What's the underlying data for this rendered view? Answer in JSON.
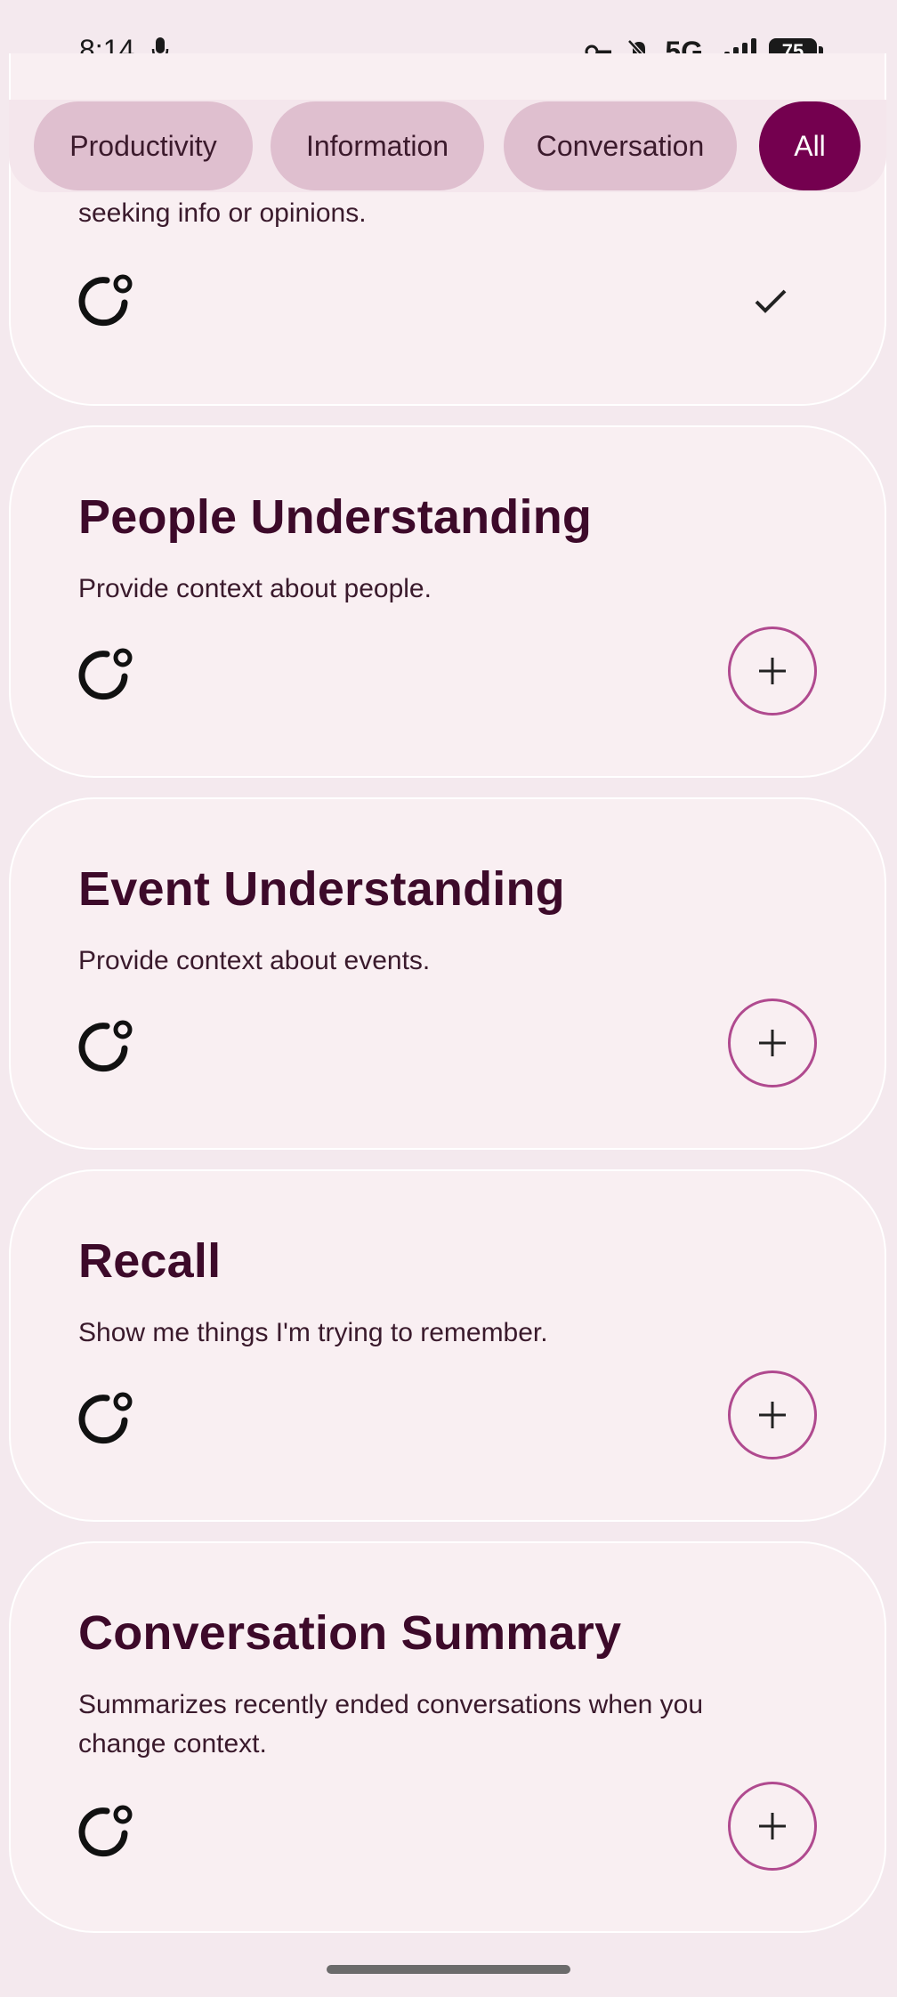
{
  "status": {
    "time": "8:14",
    "network": "5G",
    "battery": "75"
  },
  "filters": {
    "chips": [
      {
        "label": "Productivity",
        "active": false
      },
      {
        "label": "Information",
        "active": false
      },
      {
        "label": "Conversation",
        "active": false
      },
      {
        "label": "All",
        "active": true
      }
    ]
  },
  "cards": [
    {
      "title": "",
      "description": "seeking info or opinions.",
      "state": "added"
    },
    {
      "title": "People Understanding",
      "description": "Provide context about people.",
      "state": "not-added"
    },
    {
      "title": "Event Understanding",
      "description": "Provide context about events.",
      "state": "not-added"
    },
    {
      "title": "Recall",
      "description": "Show me things I'm trying to remember.",
      "state": "not-added"
    },
    {
      "title": "Conversation Summary",
      "description": "Summarizes recently ended conversations when you change context.",
      "state": "not-added"
    }
  ],
  "colors": {
    "accent": "#74004f",
    "chip": "#dfbfcf",
    "card": "#f9eff2",
    "title": "#3d0a2a"
  }
}
